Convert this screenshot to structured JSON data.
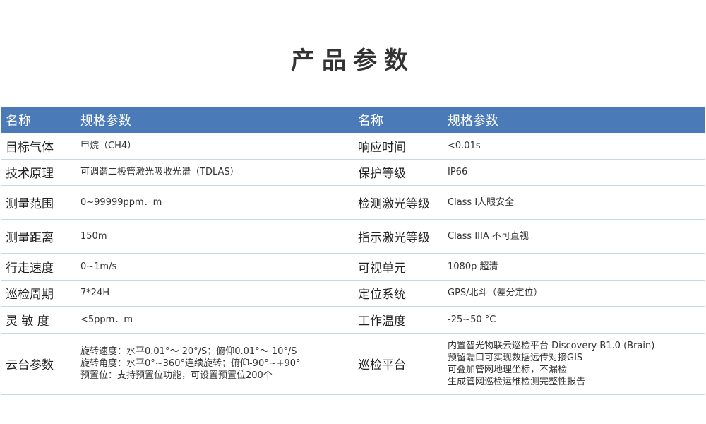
{
  "title": "产品参数",
  "header": {
    "name1": "名称",
    "spec1": "规格参数",
    "name2": "名称",
    "spec2": "规格参数"
  },
  "rows": [
    {
      "name_left": "目标气体",
      "value_left": "甲烷（CH4）",
      "name_right": "响应时间",
      "value_right": "<0.01s"
    },
    {
      "name_left": "技术原理",
      "value_left": "可调谐二极管激光吸收光谱（TDLAS）",
      "name_right": "保护等级",
      "value_right": "IP66"
    },
    {
      "name_left": "测量范围",
      "value_left": "0~99999ppm．m",
      "name_right": "检测激光等级",
      "value_right": "Class I人眼安全"
    },
    {
      "name_left": "测量距离",
      "value_left": "150m",
      "name_right": "指示激光等级",
      "value_right": "Class IIIA 不可直视"
    },
    {
      "name_left": "行走速度",
      "value_left": "0~1m/s",
      "name_right": "可视单元",
      "value_right": "1080p 超清"
    },
    {
      "name_left": "巡检周期",
      "value_left": "7*24H",
      "name_right": "定位系统",
      "value_right": "GPS/北斗（差分定位）"
    },
    {
      "name_left": "灵 敏 度",
      "value_left": "<5ppm．m",
      "name_right": "工作温度",
      "value_right": "-25~50  °C"
    }
  ],
  "last_row": {
    "name_left": "云台参数",
    "value_left_lines": [
      "旋转速度：水平0.01°～ 20°/S；俯仰0.01°～ 10°/S",
      "旋转角度：水平0°~360°连续旋转；俯仰-90°~+90°",
      "预置位：支持预置位功能，可设置预置位200个"
    ],
    "name_right": "巡检平台",
    "value_right_lines": [
      "内置智光物联云巡检平台 Discovery-B1.0 (Brain)",
      "预留端口可实现数据远传对接GIS",
      "可叠加管网地理坐标，不漏检",
      "生成管网巡检运维检测完整性报告"
    ]
  },
  "colors": {
    "header_bg": "#4a7ab8",
    "header_text": "#ffffff",
    "row_divider": "#c9d6e3"
  }
}
